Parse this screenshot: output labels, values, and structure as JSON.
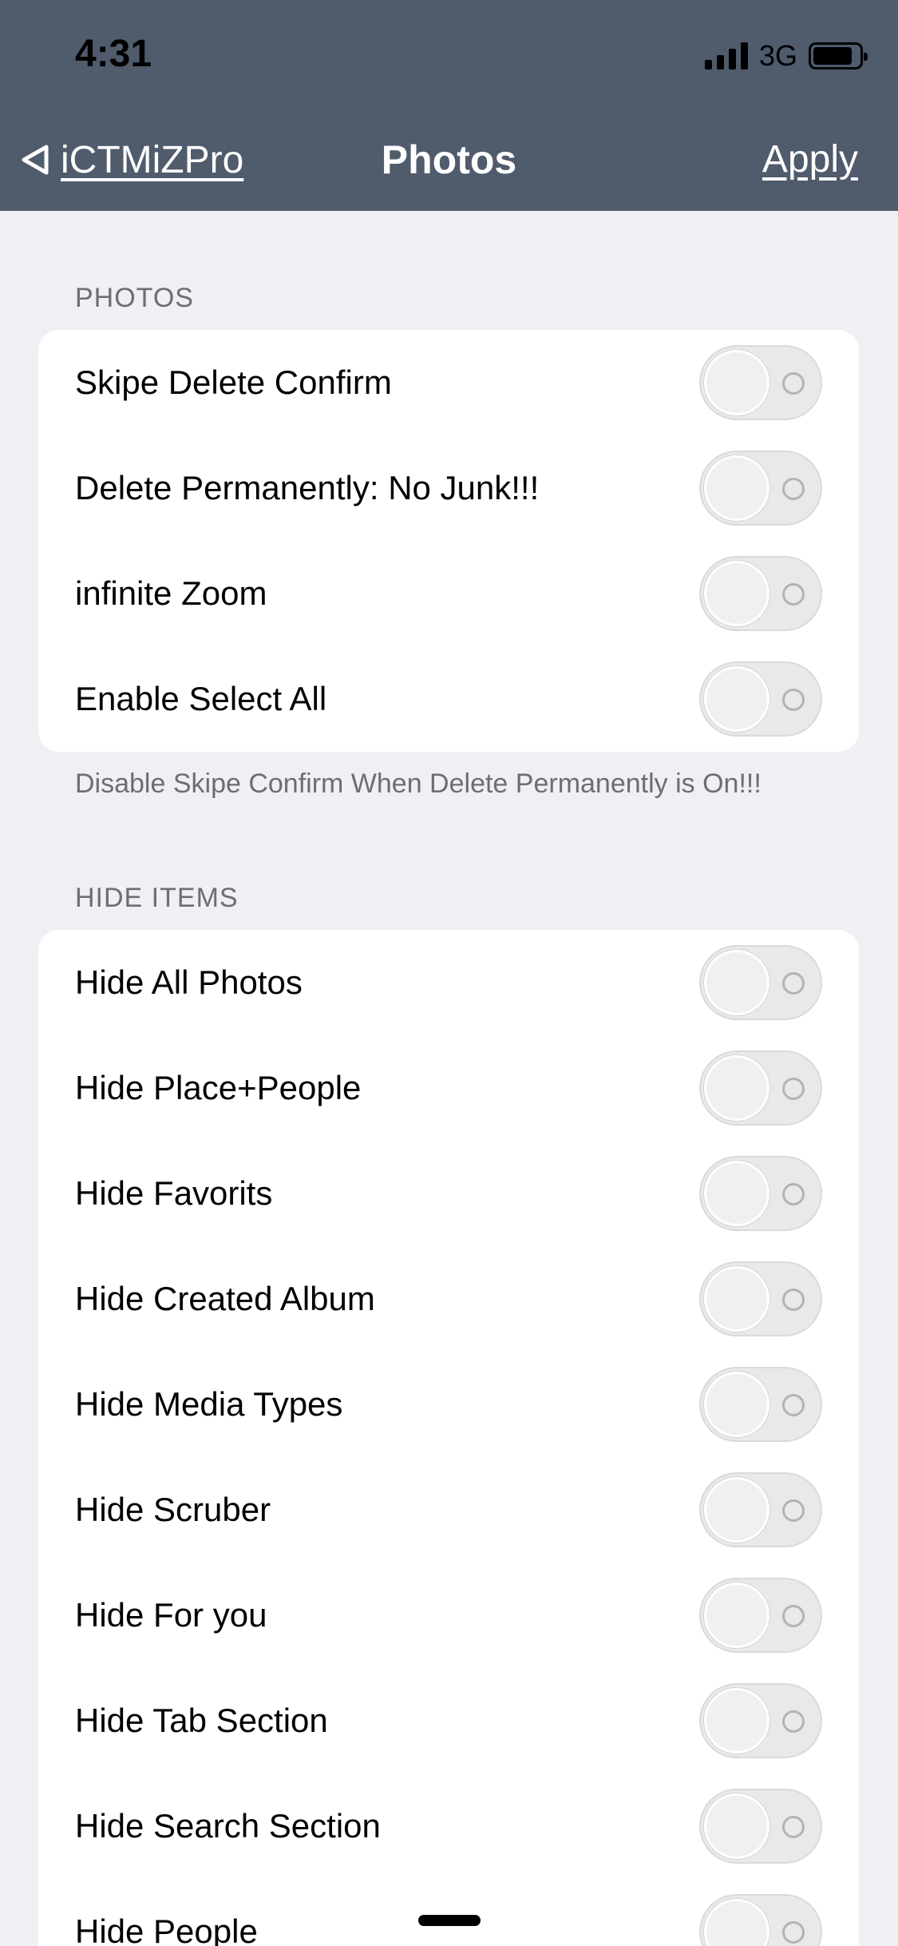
{
  "status_bar": {
    "time": "4:31",
    "network": "3G"
  },
  "nav": {
    "back_label": "iCTMiZPro",
    "title": "Photos",
    "apply_label": "Apply"
  },
  "sections": [
    {
      "header": "PHOTOS",
      "footer": "Disable Skipe Confirm When Delete Permanently is On!!!",
      "rows": [
        {
          "label": "Skipe Delete Confirm",
          "on": false
        },
        {
          "label": "Delete Permanently: No Junk!!!",
          "on": false
        },
        {
          "label": "infinite Zoom",
          "on": false
        },
        {
          "label": "Enable Select All",
          "on": false
        }
      ]
    },
    {
      "header": "HIDE ITEMS",
      "rows": [
        {
          "label": "Hide All Photos",
          "on": false
        },
        {
          "label": "Hide Place+People",
          "on": false
        },
        {
          "label": "Hide Favorits",
          "on": false
        },
        {
          "label": "Hide Created Album",
          "on": false
        },
        {
          "label": "Hide Media Types",
          "on": false
        },
        {
          "label": "Hide Scruber",
          "on": false
        },
        {
          "label": "Hide For you",
          "on": false
        },
        {
          "label": "Hide Tab Section",
          "on": false
        },
        {
          "label": "Hide Search Section",
          "on": false
        },
        {
          "label": "Hide People",
          "on": false
        }
      ]
    }
  ]
}
